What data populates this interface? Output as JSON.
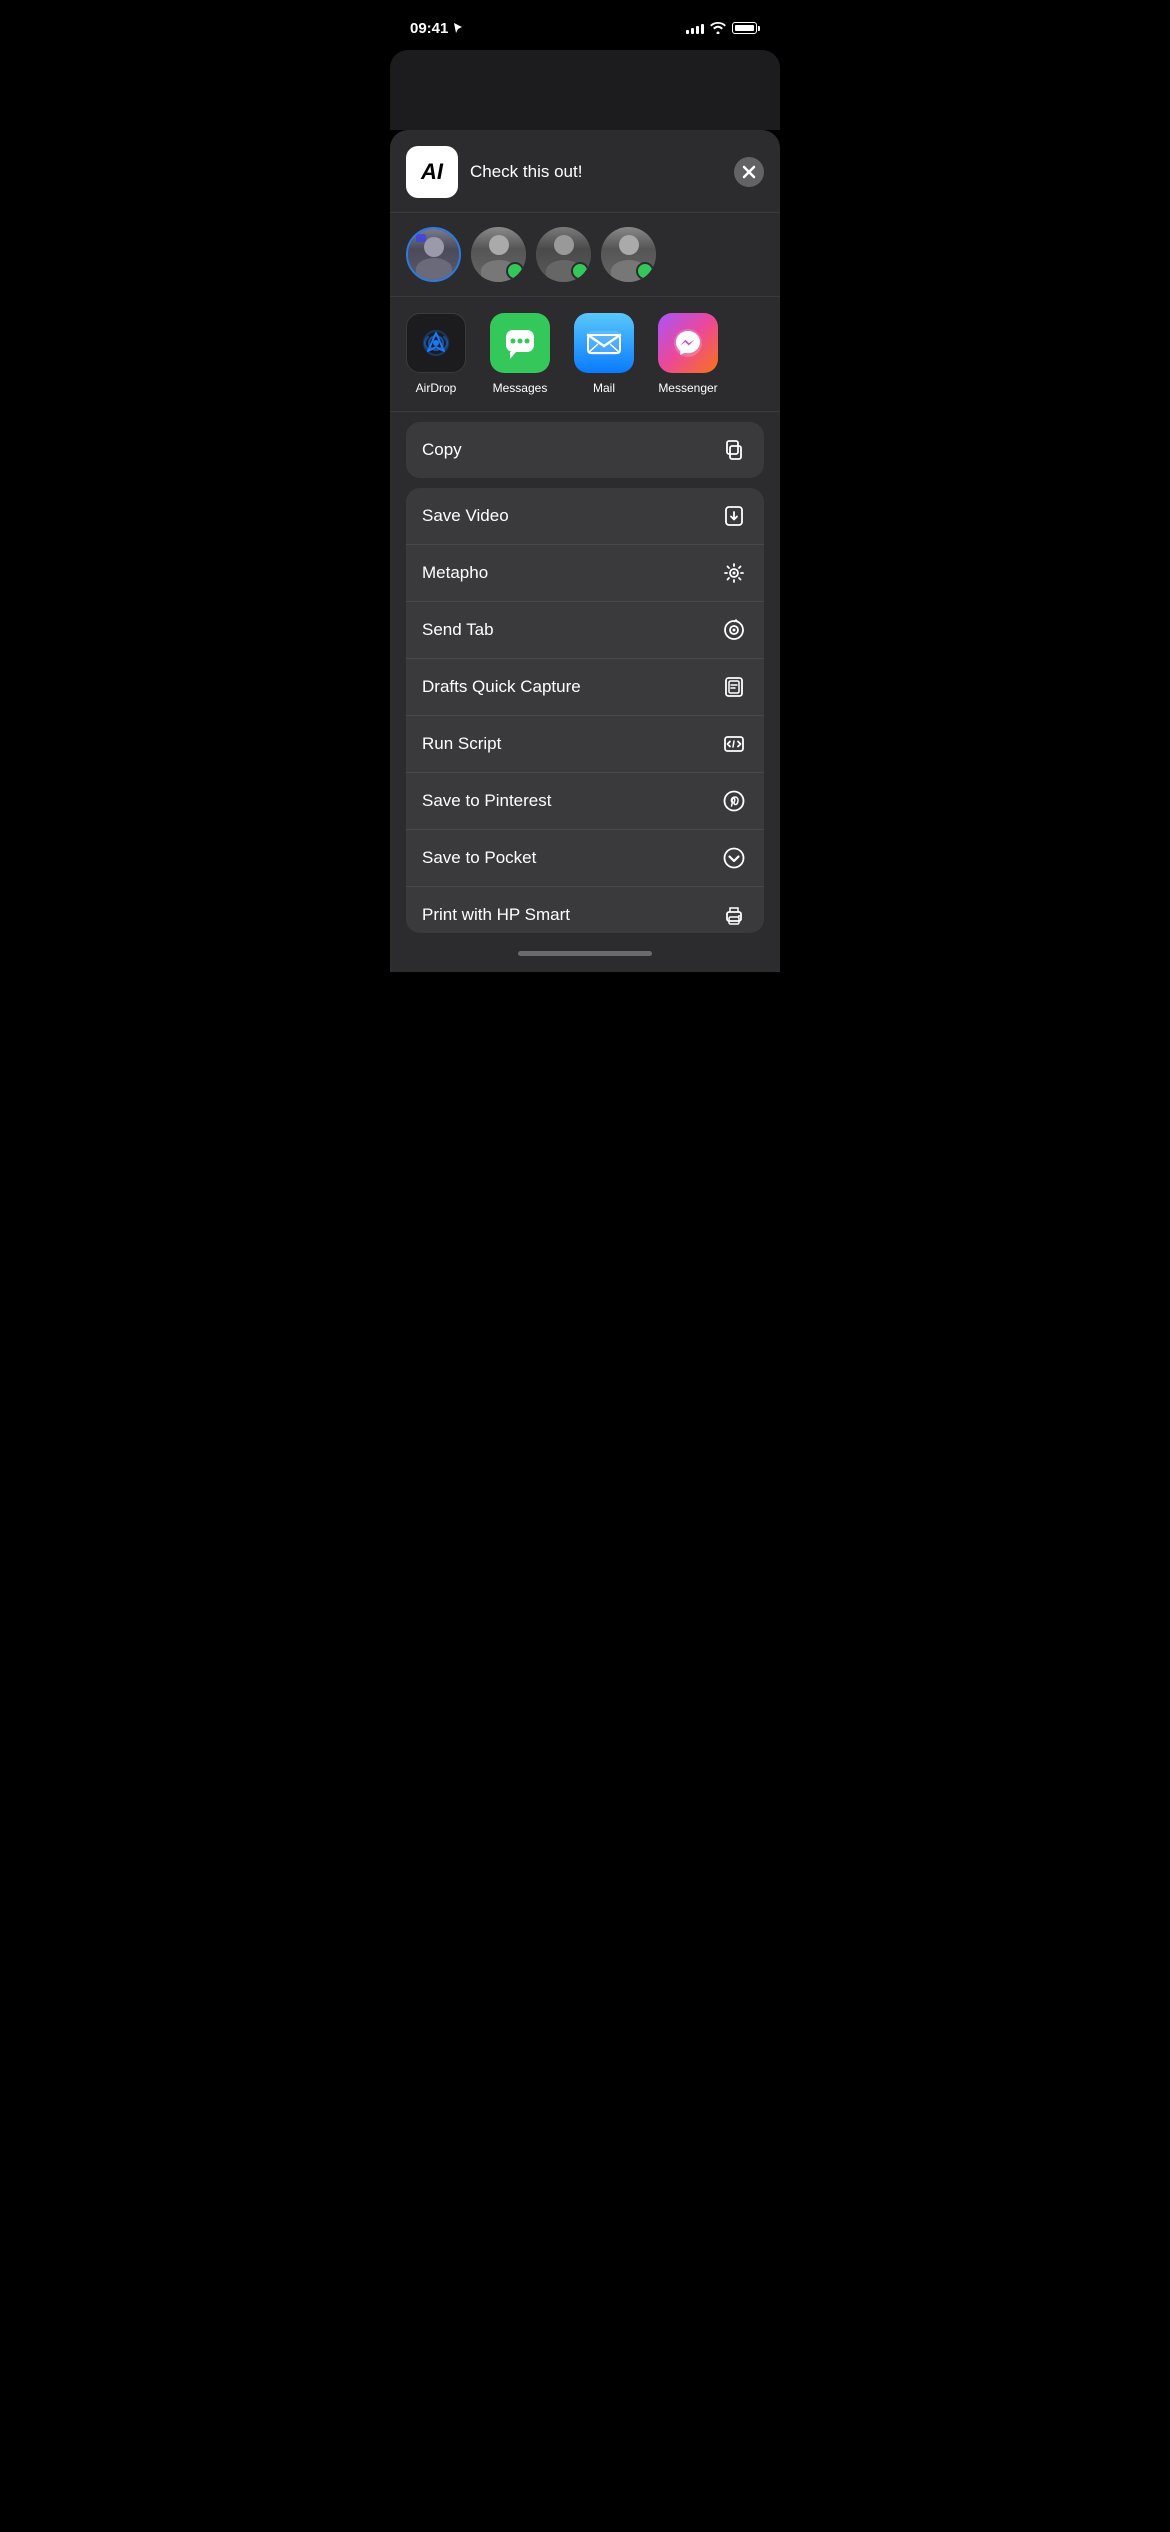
{
  "statusBar": {
    "time": "09:41",
    "locationIcon": "◁",
    "signalBars": [
      4,
      6,
      8,
      10,
      12
    ],
    "batteryLevel": 100
  },
  "shareHeader": {
    "appIconText": "AI",
    "title": "Check this out!",
    "closeLabel": "×"
  },
  "contacts": [
    {
      "id": 1,
      "hasRing": true,
      "hasDot": false
    },
    {
      "id": 2,
      "hasRing": false,
      "hasDot": true
    },
    {
      "id": 3,
      "hasRing": false,
      "hasDot": true
    },
    {
      "id": 4,
      "hasRing": false,
      "hasDot": true
    }
  ],
  "apps": [
    {
      "id": "airdrop",
      "label": "AirDrop",
      "type": "airdrop"
    },
    {
      "id": "messages",
      "label": "Messages",
      "type": "messages"
    },
    {
      "id": "mail",
      "label": "Mail",
      "type": "mail"
    },
    {
      "id": "messenger",
      "label": "Messenger",
      "type": "messenger"
    }
  ],
  "copySection": {
    "label": "Copy",
    "iconType": "copy"
  },
  "actions": [
    {
      "id": "save-video",
      "label": "Save Video",
      "iconType": "download"
    },
    {
      "id": "metapho",
      "label": "Metapho",
      "iconType": "star"
    },
    {
      "id": "send-tab",
      "label": "Send Tab",
      "iconType": "target"
    },
    {
      "id": "drafts-quick-capture",
      "label": "Drafts Quick Capture",
      "iconType": "drafts"
    },
    {
      "id": "run-script",
      "label": "Run Script",
      "iconType": "code"
    },
    {
      "id": "save-to-pinterest",
      "label": "Save to Pinterest",
      "iconType": "pinterest"
    },
    {
      "id": "save-to-pocket",
      "label": "Save to Pocket",
      "iconType": "pocket"
    },
    {
      "id": "print-with-hp",
      "label": "Print with HP Smart",
      "iconType": "printer"
    }
  ]
}
